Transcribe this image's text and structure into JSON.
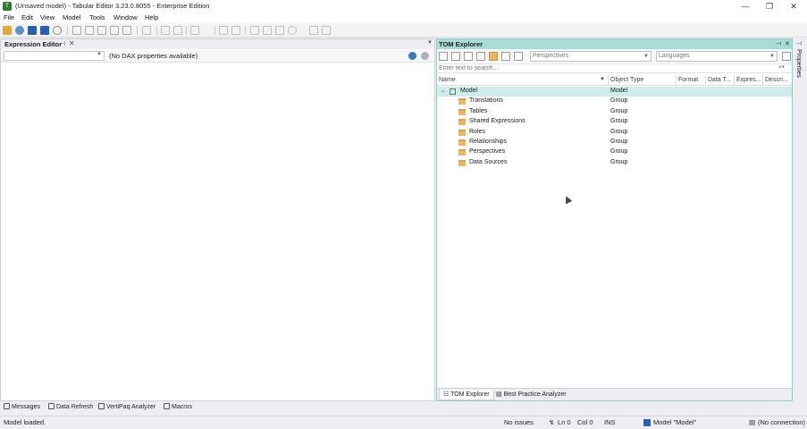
{
  "window": {
    "title": "(Unsaved model) - Tabular Editor 3.23.0.8055 - Enterprise Edition",
    "controls": {
      "minimize": "—",
      "restore": "❐",
      "close": "✕"
    }
  },
  "menu": {
    "items": [
      "File",
      "Edit",
      "View",
      "Model",
      "Tools",
      "Window",
      "Help"
    ]
  },
  "expression_editor": {
    "title": "Expression Editor",
    "pin_glyph": "⊣",
    "close_glyph": "✕",
    "property_dropdown_value": "",
    "no_dax_text": "(No DAX properties available)"
  },
  "tom_explorer": {
    "title": "TOM Explorer",
    "perspectives_placeholder": "Perspectives",
    "languages_placeholder": "Languages",
    "search_placeholder": "Enter text to search...",
    "columns": [
      "Name",
      "Object Type",
      "Format",
      "Data T...",
      "Expres...",
      "Descri..."
    ],
    "tree": [
      {
        "name": "Model",
        "type": "Model",
        "icon": "model-icon",
        "level": 0,
        "expanded": true,
        "selected": true
      },
      {
        "name": "Translations",
        "type": "Group",
        "icon": "folder-icon",
        "level": 1
      },
      {
        "name": "Tables",
        "type": "Group",
        "icon": "folder-icon",
        "level": 1
      },
      {
        "name": "Shared Expressions",
        "type": "Group",
        "icon": "folder-icon",
        "level": 1
      },
      {
        "name": "Roles",
        "type": "Group",
        "icon": "folder-icon",
        "level": 1
      },
      {
        "name": "Relationships",
        "type": "Group",
        "icon": "folder-icon",
        "level": 1
      },
      {
        "name": "Perspectives",
        "type": "Group",
        "icon": "folder-icon",
        "level": 1
      },
      {
        "name": "Data Sources",
        "type": "Group",
        "icon": "folder-icon",
        "level": 1
      }
    ],
    "bottom_tabs": [
      "TOM Explorer",
      "Best Practice Analyzer"
    ]
  },
  "properties_side_label": "Properties",
  "bottom_panel_tabs": [
    "Messages",
    "Data Refresh",
    "VertiPaq Analyzer",
    "Macros"
  ],
  "status": {
    "message": "Model loaded.",
    "issues": "No issues",
    "line": "Ln 0",
    "col": "Col 0",
    "mode": "INS",
    "model": "Model \"Model\"",
    "connection": "(No connection)"
  },
  "colors": {
    "accent": "#a8dcd6",
    "selection": "#cdeceb",
    "folder": "#e7b866"
  }
}
